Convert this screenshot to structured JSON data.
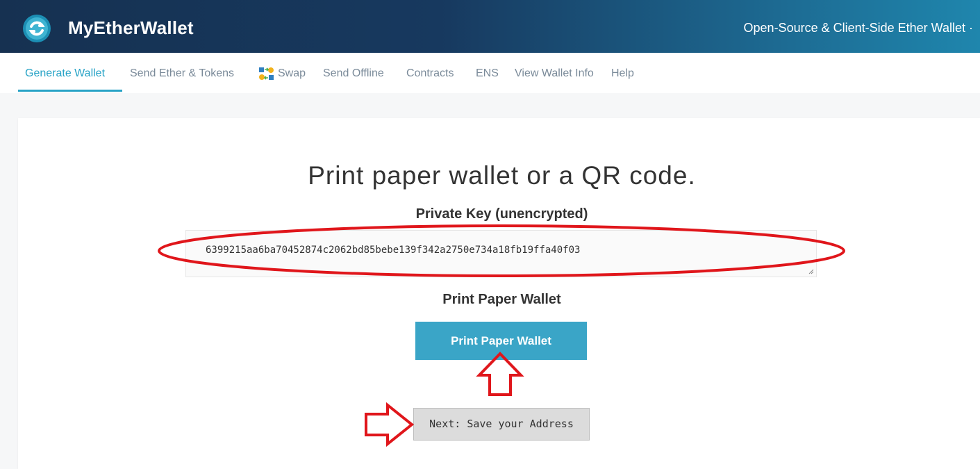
{
  "header": {
    "brand": "MyEtherWallet",
    "tagline": "Open-Source & Client-Side Ether Wallet ·",
    "logo_icon": "myetherwallet-logo-icon"
  },
  "nav": {
    "items": [
      {
        "label": "Generate Wallet",
        "active": true
      },
      {
        "label": "Send Ether & Tokens"
      },
      {
        "label": "Swap",
        "icon": "swap-icon"
      },
      {
        "label": "Send Offline"
      },
      {
        "label": "Contracts"
      },
      {
        "label": "ENS"
      },
      {
        "label": "View Wallet Info"
      },
      {
        "label": "Help"
      }
    ]
  },
  "main": {
    "heading": "Print paper wallet or a QR code.",
    "private_key_label": "Private Key (unencrypted)",
    "private_key_value": "6399215aa6ba70452874c2062bd85bebe139f342a2750e734a18fb19ffa40f03",
    "print_label": "Print Paper Wallet",
    "print_button": "Print Paper Wallet",
    "next_button": "Next: Save your Address"
  },
  "colors": {
    "accent": "#28a3c6",
    "button": "#3aa5c7",
    "annotation": "#e0161b"
  },
  "annotations": [
    "red-ellipse-icon",
    "up-arrow-icon",
    "right-arrow-icon"
  ]
}
